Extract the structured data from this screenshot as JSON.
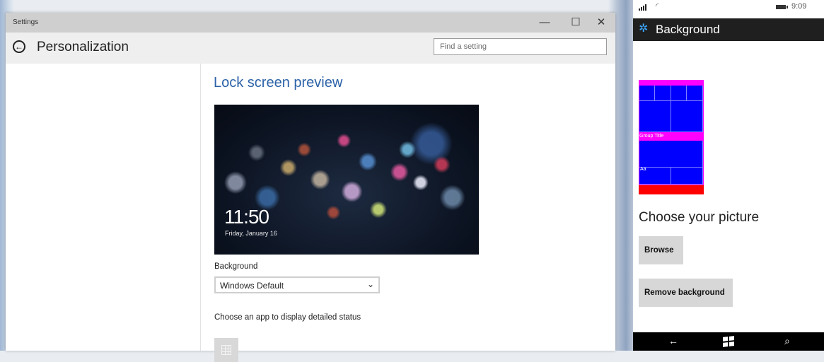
{
  "window": {
    "title": "Settings",
    "controls": {
      "minimize": "—",
      "maximize": "☐",
      "close": "✕"
    }
  },
  "header": {
    "page_title": "Personalization",
    "search_placeholder": "Find a setting"
  },
  "lock_screen": {
    "section_title": "Lock screen preview",
    "clock_time": "11:50",
    "clock_date": "Friday, January 16",
    "background_label": "Background",
    "background_value": "Windows Default",
    "status_label": "Choose an app to display detailed status"
  },
  "phone": {
    "status": {
      "time": "9:09"
    },
    "app_title": "Background",
    "tile_preview": {
      "group_title": "Group Title",
      "aa": "Aa"
    },
    "choose_heading": "Choose your picture",
    "browse_button": "Browse",
    "remove_button": "Remove background",
    "nav": {
      "back": "←",
      "search": "⌕"
    }
  },
  "colors": {
    "accent_title": "#2c62a8",
    "phone_accent": "#3aa8ff",
    "tile_magenta": "#ff00ff",
    "tile_blue": "#0000ff",
    "tile_red": "#ff0000"
  }
}
